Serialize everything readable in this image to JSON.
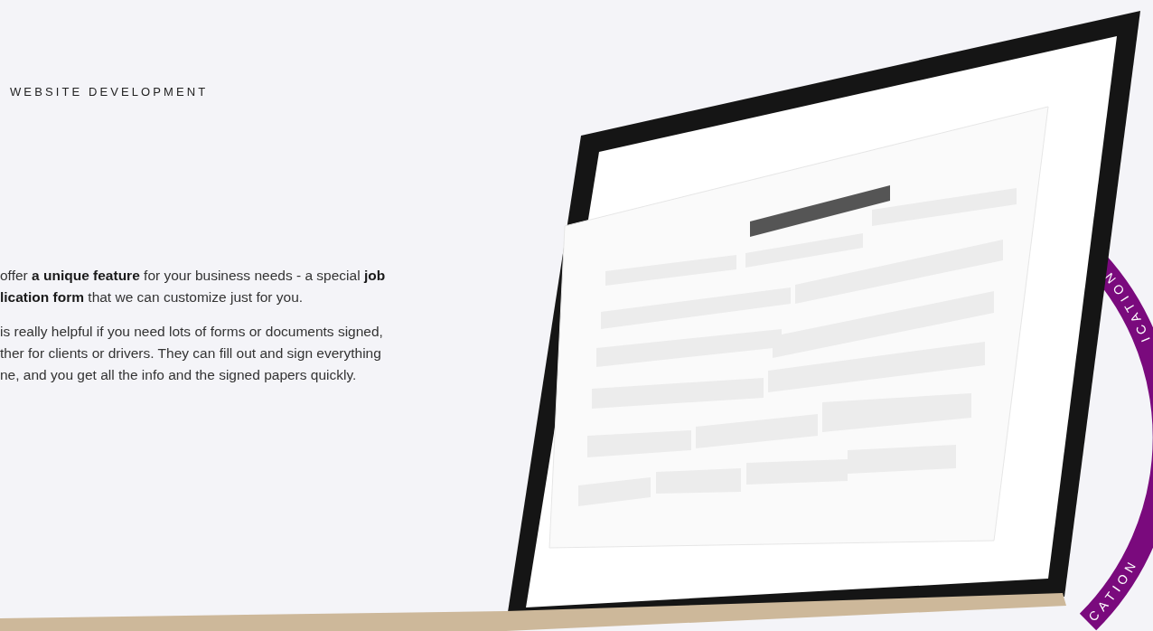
{
  "section_label": "WEBSITE DEVELOPMENT",
  "paragraphs": [
    {
      "lines": [
        "offer **a unique feature** for your business needs - a special **job**",
        "**lication form** that we can customize just for you."
      ]
    },
    {
      "lines": [
        "is really helpful if you need lots of forms or documents signed,",
        "ther for clients or drivers. They can fill out and sign everything",
        "ne, and you get all the info and the signed papers quickly."
      ]
    }
  ],
  "badge": {
    "texts": [
      "ICATION",
      "CATION"
    ]
  }
}
